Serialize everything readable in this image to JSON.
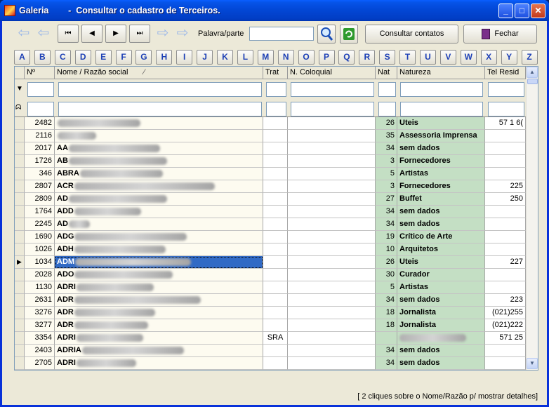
{
  "window": {
    "title": "Galeria        -  Consultar o cadastro de Terceiros."
  },
  "toolbar": {
    "first": "⏮",
    "prev": "◀",
    "next": "▶",
    "last": "⏭",
    "keyword_label": "Palavra/parte",
    "keyword_value": "",
    "consult_contacts": "Consultar contatos",
    "close": "Fechar"
  },
  "alphabet": [
    "A",
    "B",
    "C",
    "D",
    "E",
    "F",
    "G",
    "H",
    "I",
    "J",
    "K",
    "L",
    "M",
    "N",
    "O",
    "P",
    "Q",
    "R",
    "S",
    "T",
    "U",
    "V",
    "W",
    "X",
    "Y",
    "Z"
  ],
  "columns": {
    "num": "Nº",
    "name": "Nome / Razão social",
    "trat": "Trat",
    "coloquial": "N. Coloquial",
    "nat": "Nat",
    "natureza": "Natureza",
    "tel": "Tel Resid"
  },
  "rows": [
    {
      "num": "2482",
      "prefix": "",
      "trat": "",
      "nat": "26",
      "natureza": "Uteis",
      "tel": "57 1 6("
    },
    {
      "num": "2116",
      "prefix": "",
      "trat": "",
      "nat": "35",
      "natureza": "Assessoria Imprensa",
      "tel": ""
    },
    {
      "num": "2017",
      "prefix": "AA",
      "trat": "",
      "nat": "34",
      "natureza": "sem dados",
      "tel": ""
    },
    {
      "num": "1726",
      "prefix": "AB",
      "trat": "",
      "nat": "3",
      "natureza": "Fornecedores",
      "tel": ""
    },
    {
      "num": "346",
      "prefix": "ABRA",
      "trat": "",
      "nat": "5",
      "natureza": "Artistas",
      "tel": ""
    },
    {
      "num": "2807",
      "prefix": "ACR",
      "trat": "",
      "nat": "3",
      "natureza": "Fornecedores",
      "tel": "225"
    },
    {
      "num": "2809",
      "prefix": "AD",
      "trat": "",
      "nat": "27",
      "natureza": "Buffet",
      "tel": "250"
    },
    {
      "num": "1764",
      "prefix": "ADD",
      "trat": "",
      "nat": "34",
      "natureza": "sem dados",
      "tel": ""
    },
    {
      "num": "2245",
      "prefix": "AD",
      "trat": "",
      "nat": "34",
      "natureza": "sem dados",
      "tel": ""
    },
    {
      "num": "1690",
      "prefix": "ADG",
      "trat": "",
      "nat": "19",
      "natureza": "Crítico de Arte",
      "tel": ""
    },
    {
      "num": "1026",
      "prefix": "ADH",
      "trat": "",
      "nat": "10",
      "natureza": "Arquitetos",
      "tel": ""
    },
    {
      "num": "1034",
      "prefix": "ADM",
      "trat": "",
      "nat": "26",
      "natureza": "Uteis",
      "tel": "227"
    },
    {
      "num": "2028",
      "prefix": "ADO",
      "trat": "",
      "nat": "30",
      "natureza": "Curador",
      "tel": ""
    },
    {
      "num": "1130",
      "prefix": "ADRI",
      "trat": "",
      "nat": "5",
      "natureza": "Artistas",
      "tel": ""
    },
    {
      "num": "2631",
      "prefix": "ADR",
      "trat": "",
      "nat": "34",
      "natureza": "sem dados",
      "tel": "223"
    },
    {
      "num": "3276",
      "prefix": "ADR",
      "trat": "",
      "nat": "18",
      "natureza": "Jornalista",
      "tel": "(021)255"
    },
    {
      "num": "3277",
      "prefix": "ADR",
      "trat": "",
      "nat": "18",
      "natureza": "Jornalista",
      "tel": "(021)222"
    },
    {
      "num": "3354",
      "prefix": "ADRI",
      "trat": "SRA",
      "nat": "",
      "natureza": "",
      "tel": "571 25"
    },
    {
      "num": "2403",
      "prefix": "ADRIA",
      "trat": "",
      "nat": "34",
      "natureza": "sem dados",
      "tel": ""
    },
    {
      "num": "2705",
      "prefix": "ADRI",
      "trat": "",
      "nat": "34",
      "natureza": "sem dados",
      "tel": ""
    }
  ],
  "status": "[ 2 cliques sobre o Nome/Razão p/ mostrar detalhes]",
  "colors": {
    "nat_bg": "#c4dfc4",
    "selected": "#316ac5",
    "row_bg": "#fdfbf0"
  }
}
